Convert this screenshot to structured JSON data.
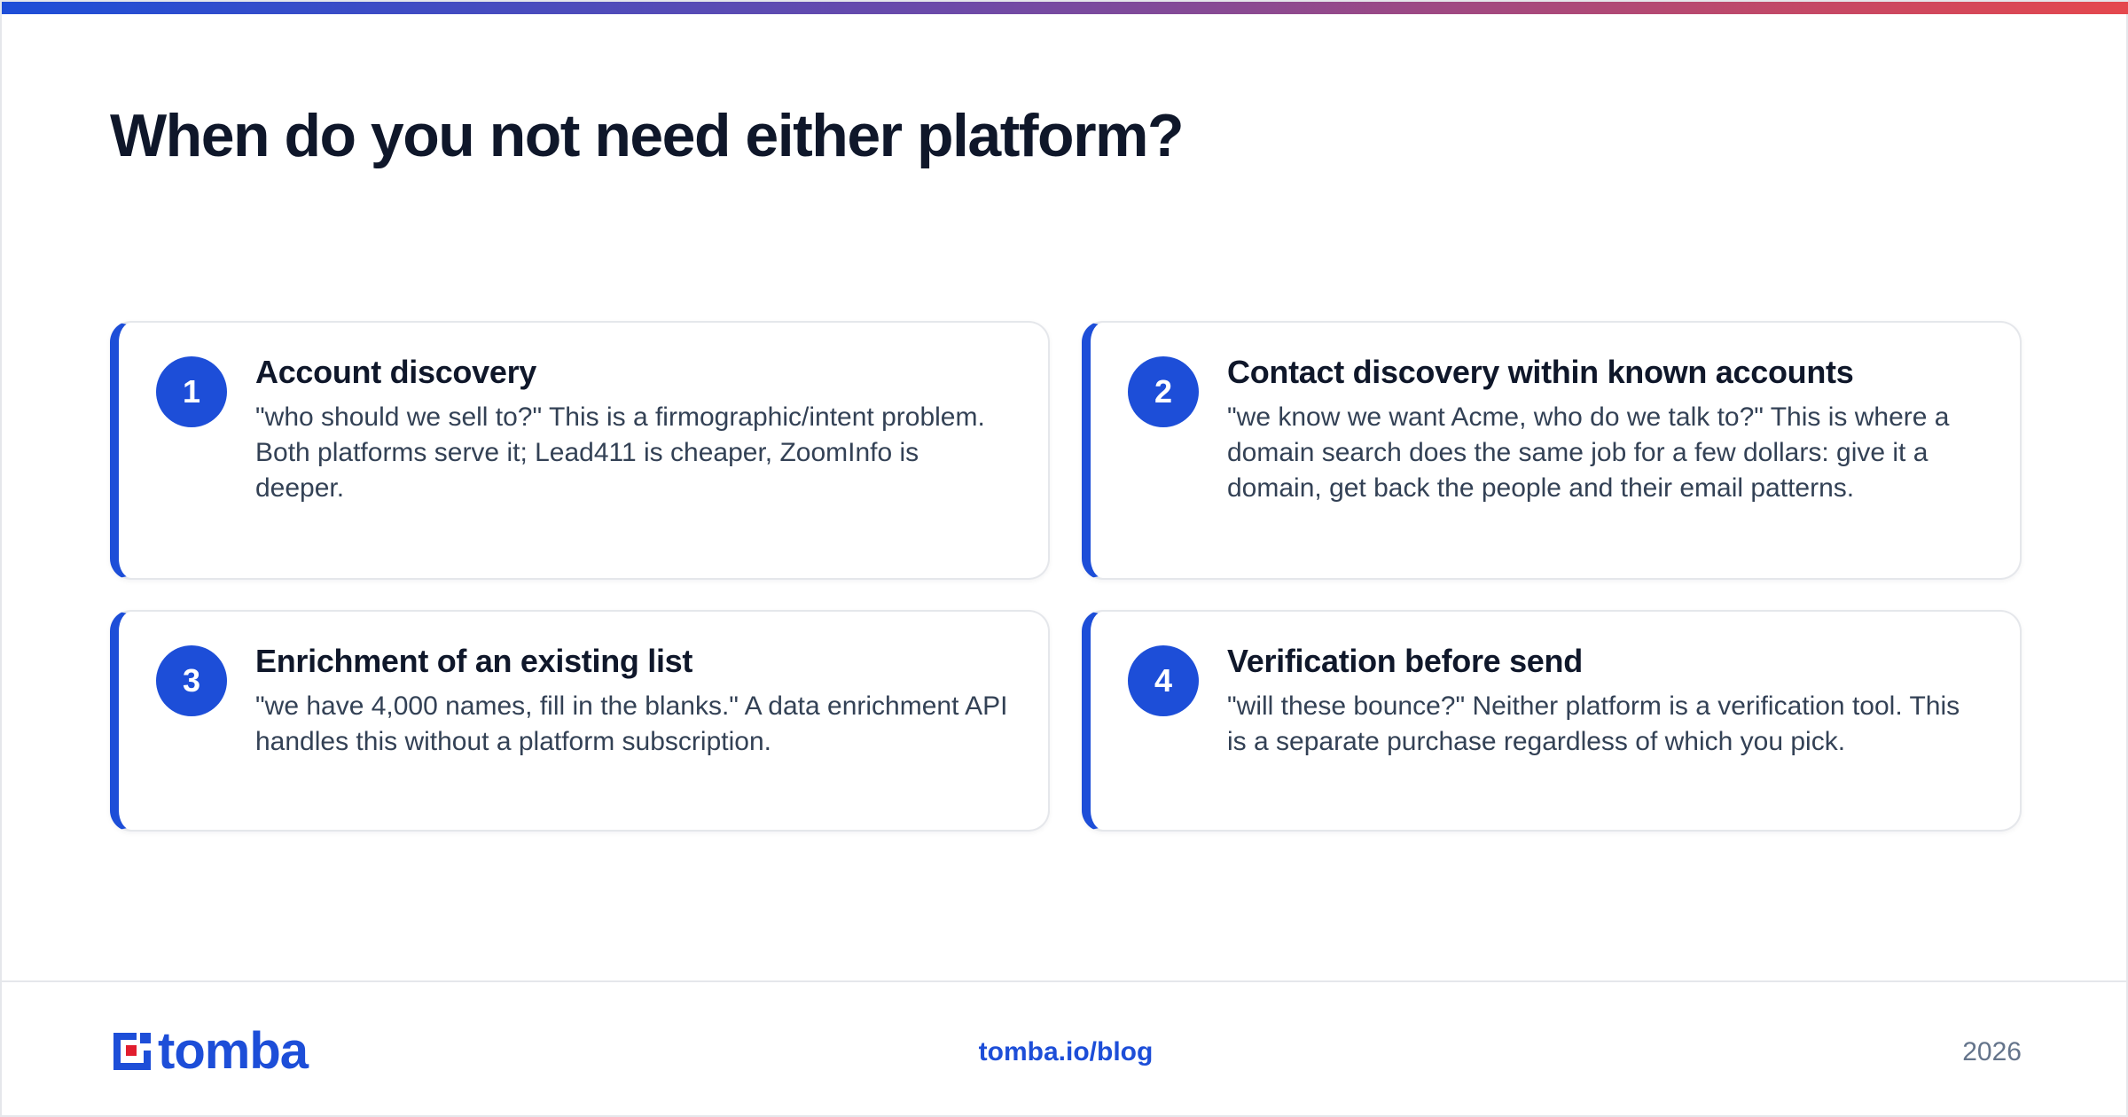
{
  "page": {
    "title": "When do you not need either platform?"
  },
  "cards": [
    {
      "number": "1",
      "title": "Account discovery",
      "body": "\"who should we sell to?\" This is a firmographic/intent problem. Both platforms serve it; Lead411 is cheaper, ZoomInfo is deeper."
    },
    {
      "number": "2",
      "title": "Contact discovery within known accounts",
      "body": "\"we know we want Acme, who do we talk to?\" This is where a domain search does the same job for a few dollars: give it a domain, get back the people and their email patterns."
    },
    {
      "number": "3",
      "title": "Enrichment of an existing list",
      "body": "\"we have 4,000 names, fill in the blanks.\" A data enrichment API handles this without a platform subscription."
    },
    {
      "number": "4",
      "title": "Verification before send",
      "body": "\"will these bounce?\" Neither platform is a verification tool. This is a separate purchase regardless of which you pick."
    }
  ],
  "footer": {
    "logo_text": "tomba",
    "link": "tomba.io/blog",
    "year": "2026"
  },
  "colors": {
    "accent": "#1d4ed8",
    "gradient_end": "#e5484d",
    "logo_red": "#e11d2e"
  },
  "icons": {
    "logo_mark": "tomba-logo-mark"
  }
}
